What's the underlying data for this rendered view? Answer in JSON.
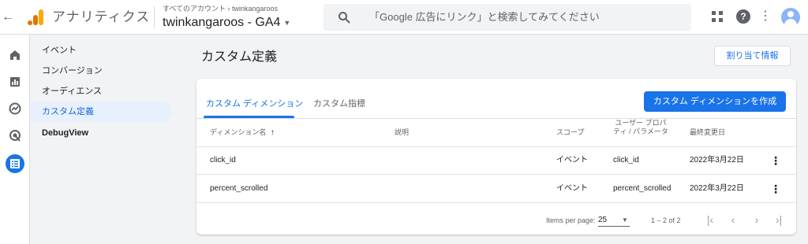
{
  "header": {
    "app_title": "アナリティクス",
    "breadcrumb": "すべてのアカウント › twinkangaroos",
    "property": "twinkangaroos - GA4",
    "search_placeholder": "「Google 広告にリンク」と検索してみてください",
    "help_glyph": "?"
  },
  "rail": {
    "icons": [
      "home-icon",
      "reports-icon",
      "explore-icon",
      "advertising-icon",
      "configure-icon"
    ],
    "active": "configure-icon"
  },
  "sidebar": {
    "items": [
      {
        "label": "イベント"
      },
      {
        "label": "コンバージョン"
      },
      {
        "label": "オーディエンス"
      },
      {
        "label": "カスタム定義"
      },
      {
        "label": "DebugView"
      }
    ]
  },
  "main": {
    "title": "カスタム定義",
    "assign_button": "割り当て情報",
    "tabs": [
      {
        "label": "カスタム ディメンション"
      },
      {
        "label": "カスタム指標"
      }
    ],
    "create_button": "カスタム ディメンションを作成",
    "table": {
      "headers": {
        "name": "ディメンション名",
        "sort_glyph": "↑",
        "description": "説明",
        "scope": "スコープ",
        "user_property": "ユーザー プロパティ / パラメータ",
        "last_modified": "最終変更日"
      },
      "rows": [
        {
          "name": "click_id",
          "description": "",
          "scope": "イベント",
          "param": "click_id",
          "date": "2022年3月22日"
        },
        {
          "name": "percent_scrolled",
          "description": "",
          "scope": "イベント",
          "param": "percent_scrolled",
          "date": "2022年3月22日"
        }
      ]
    },
    "pagination": {
      "items_per_page_label": "Items per page:",
      "items_per_page": "25",
      "range": "1 – 2 of 2"
    }
  },
  "colors": {
    "accent": "#1a73e8",
    "active_nav_bg": "#e8f0fe"
  }
}
